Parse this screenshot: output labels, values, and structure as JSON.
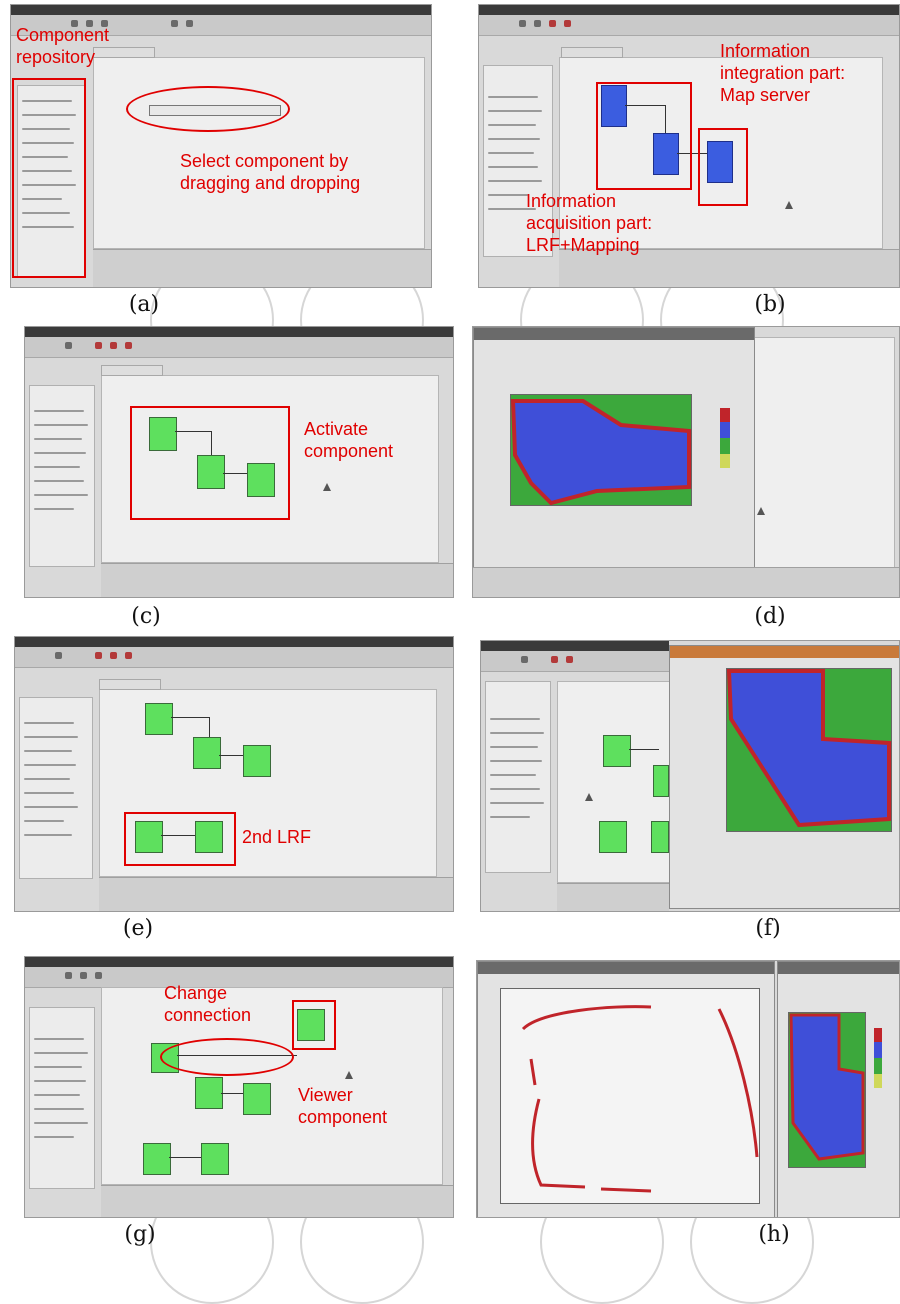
{
  "figure": {
    "panels": [
      {
        "id": "a",
        "caption": "(a)",
        "annotations": [
          "Component\nrepository",
          "Select component by\ndragging and dropping"
        ]
      },
      {
        "id": "b",
        "caption": "(b)",
        "annotations": [
          "Information\nintegration part:\nMap server",
          "Information\nacquisition part:\nLRF+Mapping"
        ]
      },
      {
        "id": "c",
        "caption": "(c)",
        "annotations": [
          "Activate\ncomponent"
        ]
      },
      {
        "id": "d",
        "caption": "(d)",
        "annotations": []
      },
      {
        "id": "e",
        "caption": "(e)",
        "annotations": [
          "2nd LRF"
        ]
      },
      {
        "id": "f",
        "caption": "(f)",
        "annotations": []
      },
      {
        "id": "g",
        "caption": "(g)",
        "annotations": [
          "Change\nconnection",
          "Viewer\ncomponent"
        ]
      },
      {
        "id": "h",
        "caption": "(h)",
        "annotations": []
      }
    ]
  },
  "colors": {
    "annotation_red": "#e00000",
    "component_green": "#5ee05e",
    "component_blue": "#3b5de0",
    "map_blue": "#3f4fd8",
    "map_green": "#3ca83c",
    "map_edge_red": "#c0242a",
    "ui_gray": "#d9d9d9"
  },
  "icons": [
    "component-block",
    "data-port",
    "mouse-cursor",
    "colorbar"
  ]
}
